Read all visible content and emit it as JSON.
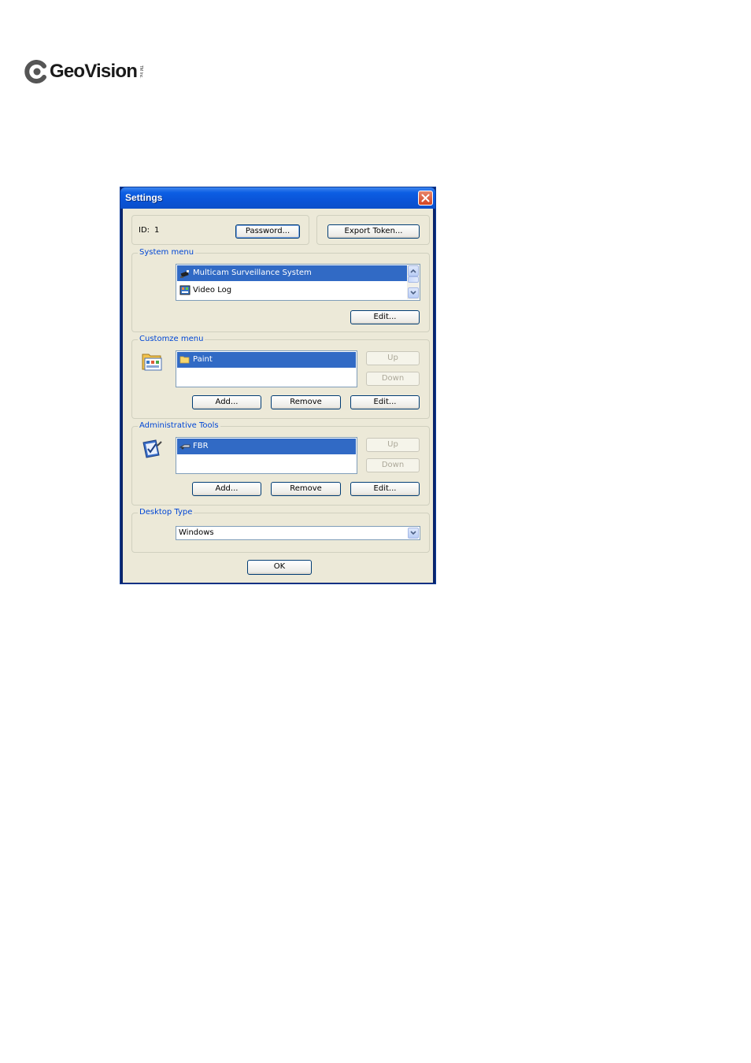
{
  "brand": {
    "name": "GeoVision",
    "tm": "TM Inc."
  },
  "window": {
    "title": "Settings"
  },
  "id_row": {
    "label": "ID:",
    "value": "1",
    "password_button": "Password...",
    "export_button": "Export Token..."
  },
  "system_menu": {
    "label": "System menu",
    "items": [
      {
        "label": "Multicam Surveillance System",
        "selected": true,
        "icon": "camera-icon"
      },
      {
        "label": "Video Log",
        "selected": false,
        "icon": "video-log-icon"
      }
    ],
    "edit_button": "Edit..."
  },
  "customize_menu": {
    "label": "Customze menu",
    "items": [
      {
        "label": "Paint",
        "selected": true,
        "icon": "folder-icon"
      }
    ],
    "up_button": "Up",
    "down_button": "Down",
    "add_button": "Add...",
    "remove_button": "Remove",
    "edit_button": "Edit..."
  },
  "admin_tools": {
    "label": "Administrative Tools",
    "items": [
      {
        "label": "FBR",
        "selected": true,
        "icon": "fbr-icon"
      }
    ],
    "up_button": "Up",
    "down_button": "Down",
    "add_button": "Add...",
    "remove_button": "Remove",
    "edit_button": "Edit..."
  },
  "desktop_type": {
    "label": "Desktop Type",
    "selected": "Windows"
  },
  "ok_button": "OK",
  "colors": {
    "title_bar": "#0a54d8",
    "client": "#ece9d8",
    "selection": "#316ac5",
    "group_label": "#0046d5",
    "close": "#d44422"
  }
}
